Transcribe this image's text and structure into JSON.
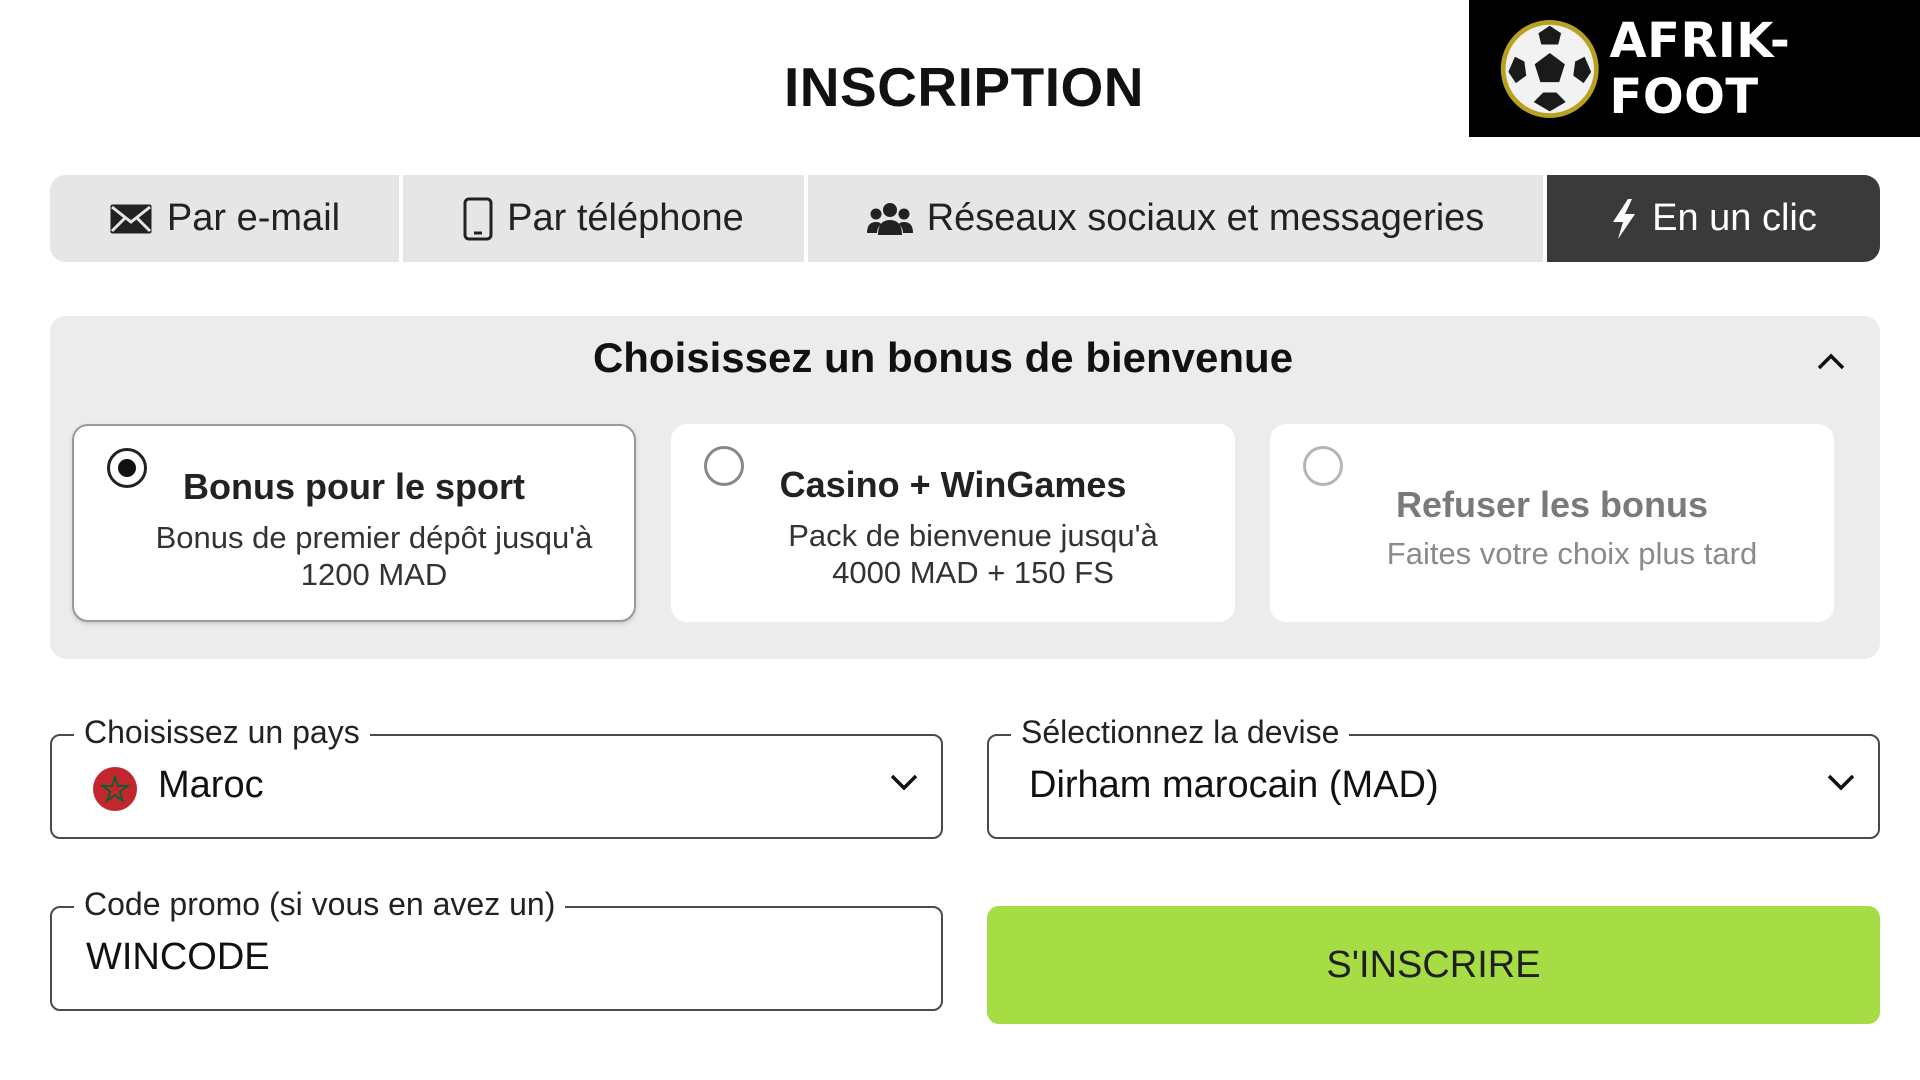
{
  "page": {
    "title": "INSCRIPTION"
  },
  "logo": {
    "text": "AFRIK-FOOT"
  },
  "tabs": [
    {
      "label": "Par e-mail",
      "icon": "envelope-icon",
      "active": false
    },
    {
      "label": "Par téléphone",
      "icon": "phone-icon",
      "active": false
    },
    {
      "label": "Réseaux sociaux et messageries",
      "icon": "users-icon",
      "active": false
    },
    {
      "label": "En un clic",
      "icon": "lightning-icon",
      "active": true
    }
  ],
  "bonus": {
    "title": "Choisissez un bonus de bienvenue",
    "options": [
      {
        "title": "Bonus pour le sport",
        "line1": "Bonus de premier dépôt jusqu'à",
        "line2": "1200 MAD",
        "selected": true
      },
      {
        "title": "Casino + WinGames",
        "line1": "Pack de bienvenue jusqu'à",
        "line2": "4000 MAD + 150 FS",
        "selected": false
      },
      {
        "title": "Refuser les bonus",
        "line1": "Faites votre choix plus tard",
        "selected": false
      }
    ]
  },
  "form": {
    "country": {
      "label": "Choisissez un pays",
      "value": "Maroc"
    },
    "currency": {
      "label": "Sélectionnez la devise",
      "value": "Dirham marocain (MAD)"
    },
    "promo": {
      "label": "Code promo (si vous en avez un)",
      "value": "WINCODE"
    },
    "submit_label": "S'INSCRIRE"
  },
  "colors": {
    "accent_green": "#a6dc44",
    "active_tab": "#3a3a3a",
    "tab_bg": "#e6e6e6",
    "panel_bg": "#ececec",
    "flag_red": "#c1272d",
    "flag_star": "#006233"
  }
}
